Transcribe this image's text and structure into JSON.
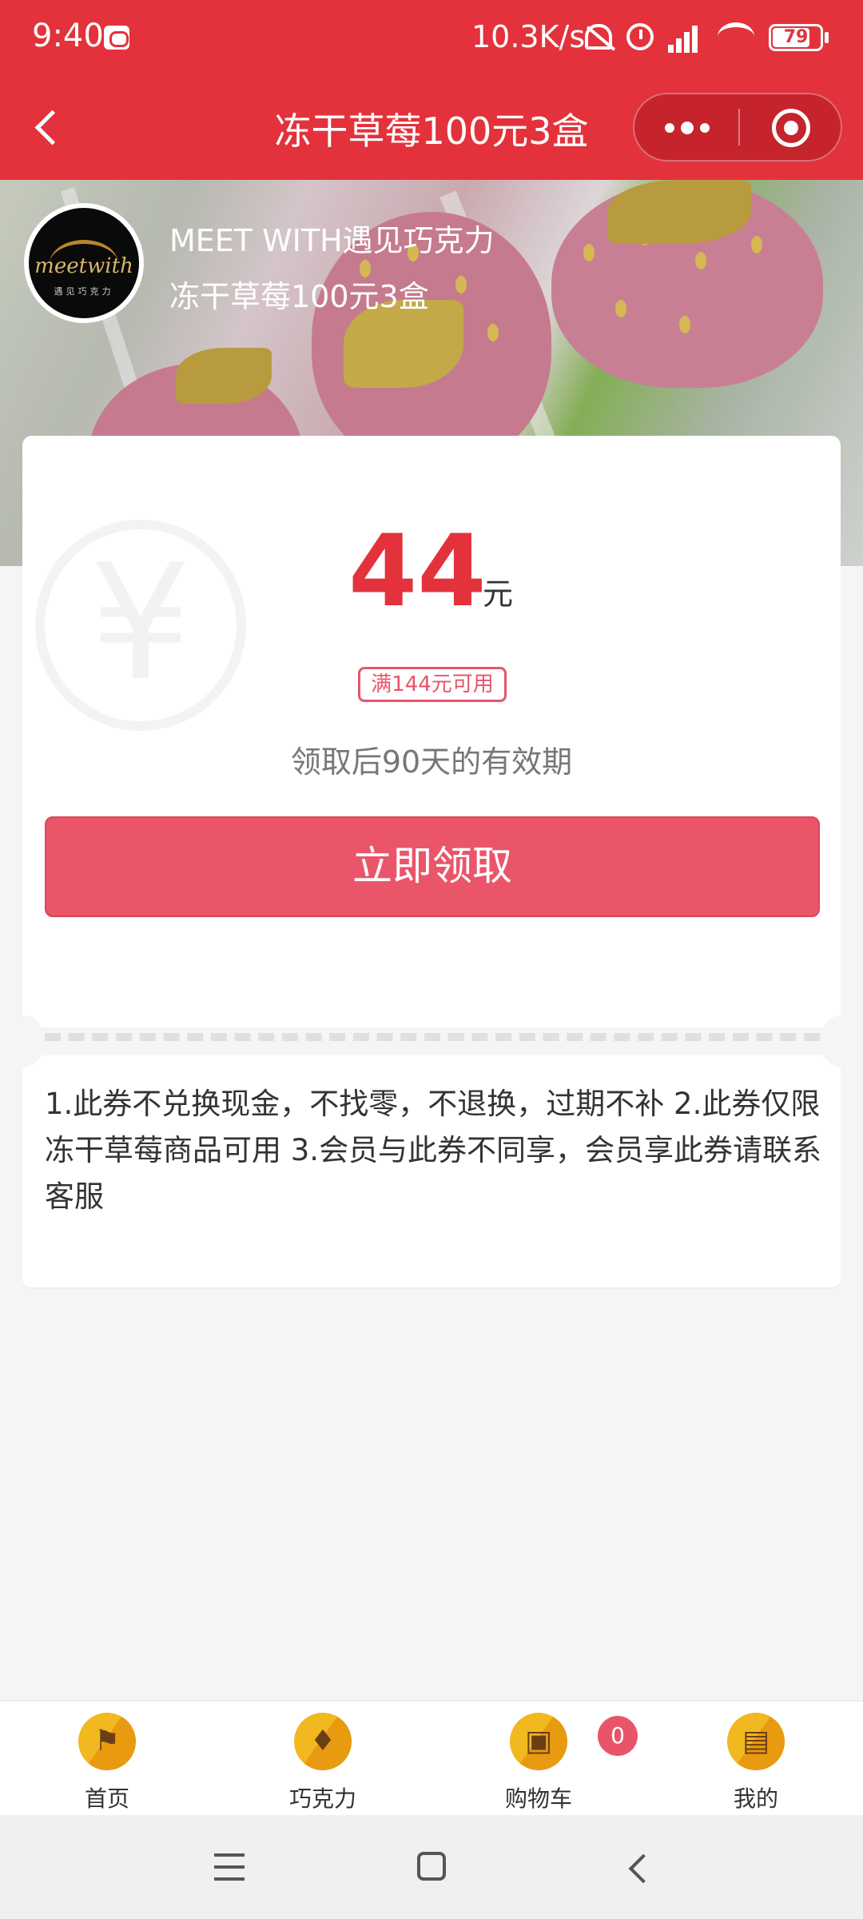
{
  "status_bar": {
    "time": "9:40",
    "network_speed": "10.3K/s",
    "battery": "79",
    "battery_level": 0.79,
    "icons": [
      "message-icon",
      "mute-icon",
      "alarm-icon",
      "signal-icon",
      "wifi-icon",
      "battery-icon"
    ]
  },
  "nav": {
    "title": "冻干草莓100元3盒",
    "icons": [
      "back-icon",
      "more-icon",
      "close-miniprogram-icon"
    ]
  },
  "banner": {
    "shop_name": "MEET WITH遇见巧克力",
    "subtitle": "冻干草莓100元3盒",
    "logo_text": "meetwith",
    "logo_subtext": "遇见巧克力"
  },
  "coupon": {
    "amount": "44",
    "unit": "元",
    "condition": "满144元可用",
    "validity": "领取后90天的有效期",
    "claim_label": "立即领取",
    "watermark": "¥",
    "rules": "1.此券不兑换现金，不找零，不退换，过期不补 2.此券仅限冻干草莓商品可用 3.会员与此券不同享，会员享此券请联系客服"
  },
  "tabbar": {
    "items": [
      {
        "label": "首页",
        "icon": "home-flag-icon",
        "glyph": "⚑"
      },
      {
        "label": "巧克力",
        "icon": "ice-cream-icon",
        "glyph": "♦"
      },
      {
        "label": "购物车",
        "icon": "tv-cart-icon",
        "glyph": "▣"
      },
      {
        "label": "我的",
        "icon": "wallet-icon",
        "glyph": "▤"
      }
    ],
    "cart_count": "0"
  },
  "colors": {
    "brand_red": "#e3323b",
    "button_pink": "#ea556a",
    "tab_icon_yellow": "#f2b820"
  }
}
